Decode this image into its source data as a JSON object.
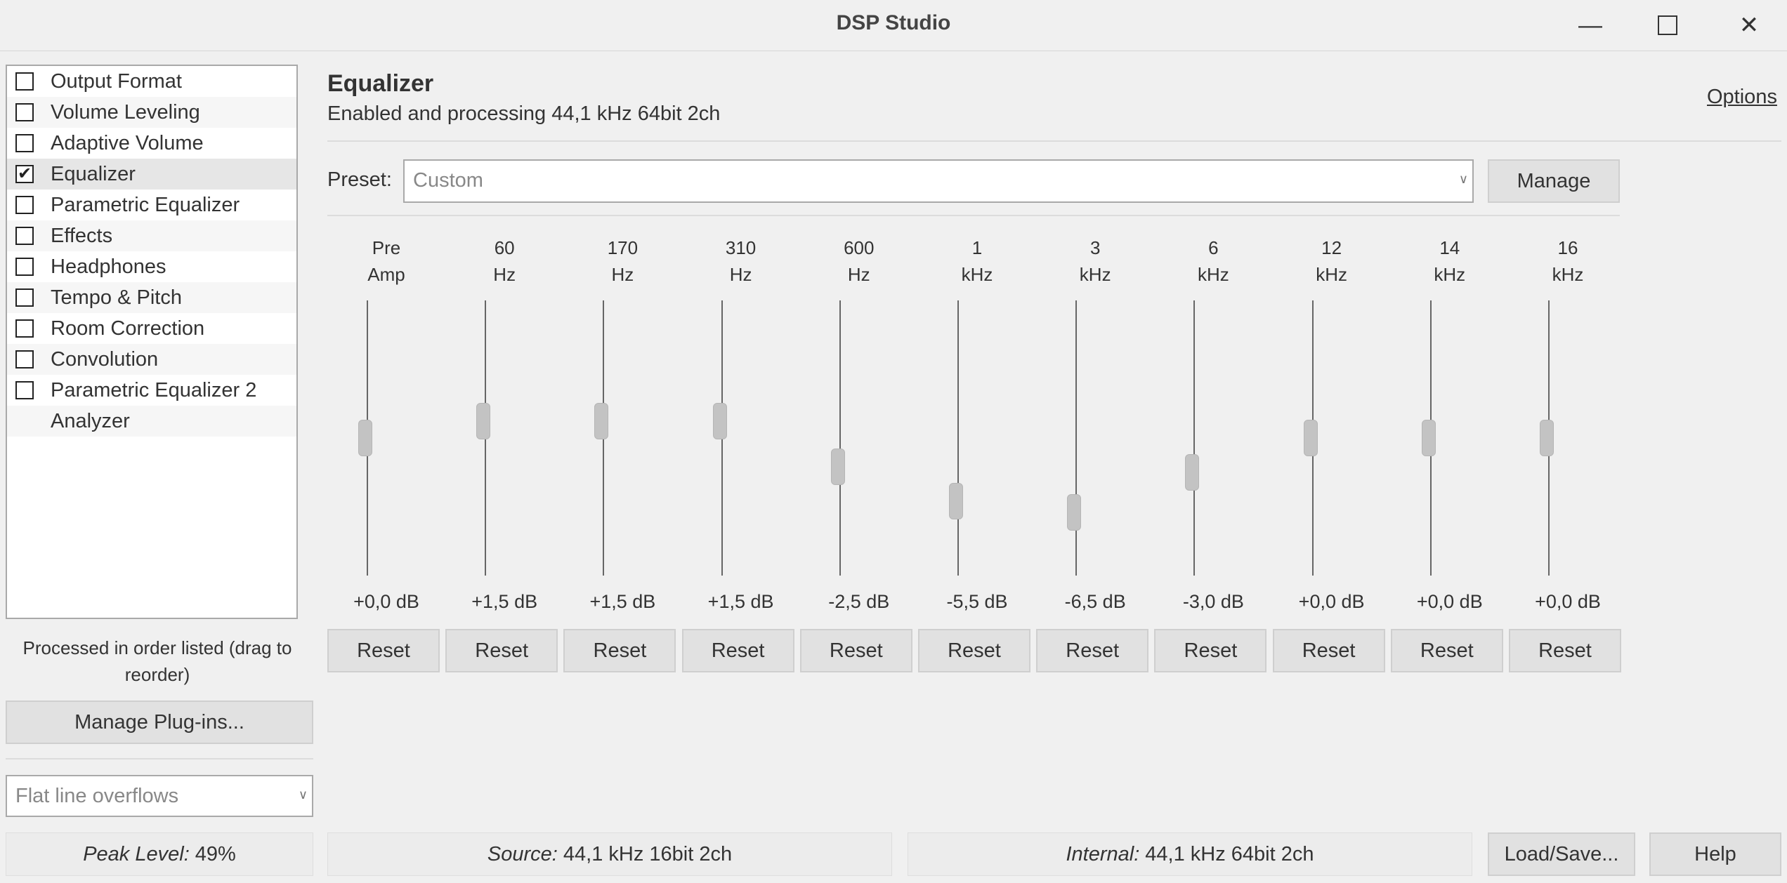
{
  "window": {
    "title": "DSP Studio"
  },
  "dsp_list": [
    {
      "label": "Output Format",
      "checked": false,
      "has_checkbox": true
    },
    {
      "label": "Volume Leveling",
      "checked": false,
      "has_checkbox": true
    },
    {
      "label": "Adaptive Volume",
      "checked": false,
      "has_checkbox": true
    },
    {
      "label": "Equalizer",
      "checked": true,
      "has_checkbox": true
    },
    {
      "label": "Parametric Equalizer",
      "checked": false,
      "has_checkbox": true
    },
    {
      "label": "Effects",
      "checked": false,
      "has_checkbox": true
    },
    {
      "label": "Headphones",
      "checked": false,
      "has_checkbox": true
    },
    {
      "label": "Tempo & Pitch",
      "checked": false,
      "has_checkbox": true
    },
    {
      "label": "Room Correction",
      "checked": false,
      "has_checkbox": true
    },
    {
      "label": "Convolution",
      "checked": false,
      "has_checkbox": true
    },
    {
      "label": "Parametric Equalizer 2",
      "checked": false,
      "has_checkbox": true
    },
    {
      "label": "Analyzer",
      "checked": false,
      "has_checkbox": false
    }
  ],
  "sidebar": {
    "order_note": "Processed in order listed (drag to reorder)",
    "manage_plugins_label": "Manage Plug-ins...",
    "overflow_select": "Flat line overflows"
  },
  "equalizer": {
    "title": "Equalizer",
    "status": "Enabled and processing 44,1 kHz 64bit 2ch",
    "options_label": "Options",
    "preset_label": "Preset:",
    "preset_value": "Custom",
    "manage_label": "Manage",
    "reset_label": "Reset",
    "range_db": [
      -12,
      12
    ],
    "bands": [
      {
        "line1": "Pre",
        "line2": "Amp",
        "value_text": "+0,0 dB",
        "slider_db": 0.0
      },
      {
        "line1": "60",
        "line2": "Hz",
        "value_text": "+1,5 dB",
        "slider_db": 1.5
      },
      {
        "line1": "170",
        "line2": "Hz",
        "value_text": "+1,5 dB",
        "slider_db": 1.5
      },
      {
        "line1": "310",
        "line2": "Hz",
        "value_text": "+1,5 dB",
        "slider_db": 1.5
      },
      {
        "line1": "600",
        "line2": "Hz",
        "value_text": "-2,5 dB",
        "slider_db": -2.5
      },
      {
        "line1": "1",
        "line2": "kHz",
        "value_text": "-5,5 dB",
        "slider_db": -5.5
      },
      {
        "line1": "3",
        "line2": "kHz",
        "value_text": "-6,5 dB",
        "slider_db": -6.5
      },
      {
        "line1": "6",
        "line2": "kHz",
        "value_text": "-3,0 dB",
        "slider_db": -3.0
      },
      {
        "line1": "12",
        "line2": "kHz",
        "value_text": "+0,0 dB",
        "slider_db": 0.0
      },
      {
        "line1": "14",
        "line2": "kHz",
        "value_text": "+0,0 dB",
        "slider_db": 0.0
      },
      {
        "line1": "16",
        "line2": "kHz",
        "value_text": "+0,0 dB",
        "slider_db": 0.0
      }
    ]
  },
  "statusbar": {
    "peak_label": "Peak Level:",
    "peak_value": "49%",
    "source_label": "Source:",
    "source_value": "44,1 kHz 16bit 2ch",
    "internal_label": "Internal:",
    "internal_value": "44,1 kHz 64bit 2ch",
    "load_save_label": "Load/Save...",
    "help_label": "Help"
  }
}
